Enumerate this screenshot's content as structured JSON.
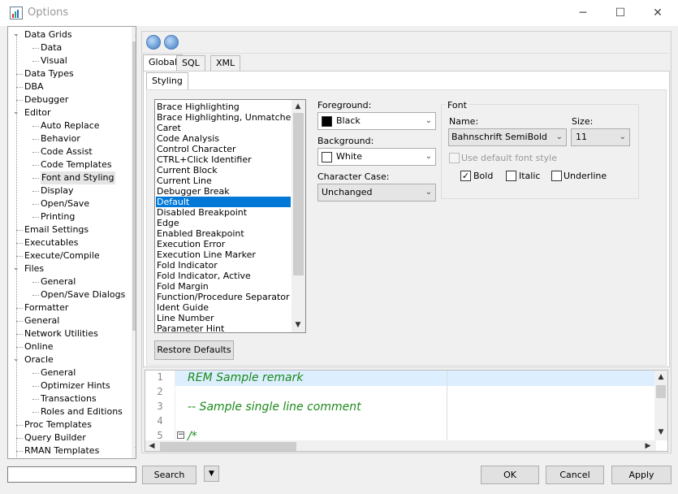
{
  "window": {
    "title": "Options",
    "minimize": "─",
    "maximize": "☐",
    "close": "✕"
  },
  "tree": {
    "items": [
      {
        "label": "Data Grids",
        "level": 0,
        "toggle": "⌄"
      },
      {
        "label": "Data",
        "level": 1
      },
      {
        "label": "Visual",
        "level": 1
      },
      {
        "label": "Data Types",
        "level": 0
      },
      {
        "label": "DBA",
        "level": 0
      },
      {
        "label": "Debugger",
        "level": 0
      },
      {
        "label": "Editor",
        "level": 0,
        "toggle": "⌄"
      },
      {
        "label": "Auto Replace",
        "level": 1
      },
      {
        "label": "Behavior",
        "level": 1
      },
      {
        "label": "Code Assist",
        "level": 1
      },
      {
        "label": "Code Templates",
        "level": 1
      },
      {
        "label": "Font and Styling",
        "level": 1,
        "selected": true
      },
      {
        "label": "Display",
        "level": 1
      },
      {
        "label": "Open/Save",
        "level": 1
      },
      {
        "label": "Printing",
        "level": 1
      },
      {
        "label": "Email Settings",
        "level": 0
      },
      {
        "label": "Executables",
        "level": 0
      },
      {
        "label": "Execute/Compile",
        "level": 0
      },
      {
        "label": "Files",
        "level": 0,
        "toggle": "⌄"
      },
      {
        "label": "General",
        "level": 1
      },
      {
        "label": "Open/Save Dialogs",
        "level": 1
      },
      {
        "label": "Formatter",
        "level": 0
      },
      {
        "label": "General",
        "level": 0
      },
      {
        "label": "Network Utilities",
        "level": 0
      },
      {
        "label": "Online",
        "level": 0
      },
      {
        "label": "Oracle",
        "level": 0,
        "toggle": "⌄"
      },
      {
        "label": "General",
        "level": 1
      },
      {
        "label": "Optimizer Hints",
        "level": 1
      },
      {
        "label": "Transactions",
        "level": 1
      },
      {
        "label": "Roles and Editions",
        "level": 1
      },
      {
        "label": "Proc Templates",
        "level": 0
      },
      {
        "label": "Query Builder",
        "level": 0
      },
      {
        "label": "RMAN Templates",
        "level": 0
      }
    ]
  },
  "tabs": [
    "Global",
    "SQL",
    "XML"
  ],
  "subtab": "Styling",
  "elements": [
    "Brace Highlighting",
    "Brace Highlighting, Unmatched",
    "Caret",
    "Code Analysis",
    "Control Character",
    "CTRL+Click Identifier",
    "Current Block",
    "Current Line",
    "Debugger Break",
    "Default",
    "Disabled Breakpoint",
    "Edge",
    "Enabled Breakpoint",
    "Execution Error",
    "Execution Line Marker",
    "Fold Indicator",
    "Fold Indicator, Active",
    "Fold Margin",
    "Function/Procedure Separator",
    "Ident Guide",
    "Line Number",
    "Parameter Hint"
  ],
  "selected_element": "Default",
  "foreground": {
    "label": "Foreground:",
    "value": "Black",
    "color": "#000000"
  },
  "background": {
    "label": "Background:",
    "value": "White",
    "color": "#ffffff"
  },
  "character_case": {
    "label": "Character Case:",
    "value": "Unchanged"
  },
  "font": {
    "group": "Font",
    "name_label": "Name:",
    "name": "Bahnschrift SemiBold",
    "size_label": "Size:",
    "size": "11",
    "use_default": "Use default font style",
    "bold": "Bold",
    "italic": "Italic",
    "underline": "Underline",
    "bold_checked": "✓"
  },
  "restore_defaults": "Restore Defaults",
  "editor": {
    "lines": [
      {
        "n": "1",
        "text": "REM Sample remark"
      },
      {
        "n": "2",
        "text": ""
      },
      {
        "n": "3",
        "text": "-- Sample single line comment"
      },
      {
        "n": "4",
        "text": ""
      },
      {
        "n": "5",
        "text": "/*"
      }
    ],
    "fold": "−"
  },
  "bottom": {
    "search": "Search",
    "ok": "OK",
    "cancel": "Cancel",
    "apply": "Apply",
    "search_value": ""
  }
}
